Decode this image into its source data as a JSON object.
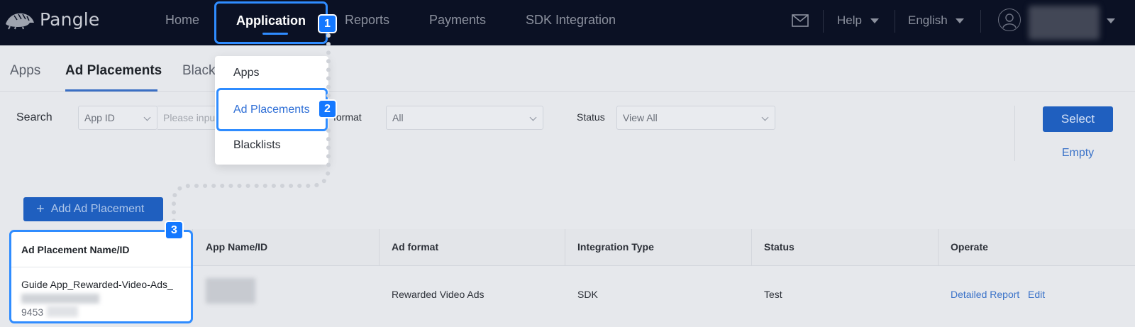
{
  "topnav": {
    "logo_text": "Pangle",
    "items": [
      {
        "label": "Home"
      },
      {
        "label": "Application"
      },
      {
        "label": "Reports"
      },
      {
        "label": "Payments"
      },
      {
        "label": "SDK Integration"
      }
    ],
    "active_item": "Application",
    "help_label": "Help",
    "language_label": "English"
  },
  "dropdown": {
    "items": [
      "Apps",
      "Ad Placements",
      "Blacklists"
    ],
    "highlighted": "Ad Placements"
  },
  "subnav": {
    "tabs": [
      "Apps",
      "Ad Placements",
      "Black"
    ],
    "active_tab": "Ad Placements"
  },
  "filters": {
    "search_label": "Search",
    "search_type_value": "App ID",
    "search_placeholder": "Please inpu",
    "ad_format_label": "format",
    "ad_format_value": "All",
    "status_label": "Status",
    "status_value": "View All",
    "select_button": "Select",
    "empty_button": "Empty"
  },
  "actions": {
    "add_placement_label": "Add Ad Placement"
  },
  "table": {
    "columns": [
      "Ad Placement Name/ID",
      "App Name/ID",
      "Ad format",
      "Integration Type",
      "Status",
      "Operate"
    ],
    "rows": [
      {
        "placement_name": "Guide App_Rewarded-Video-Ads_",
        "placement_id_prefix": "9453",
        "ad_format": "Rewarded Video Ads",
        "integration_type": "SDK",
        "status": "Test",
        "operate": [
          "Detailed Report",
          "Edit"
        ]
      }
    ]
  },
  "steps": [
    "1",
    "2",
    "3"
  ],
  "colors": {
    "nav_bg": "#0b1124",
    "highlight": "#2f8cff",
    "badge": "#1478ff",
    "primary_button": "#1f5fbf",
    "link": "#3a72c8"
  }
}
